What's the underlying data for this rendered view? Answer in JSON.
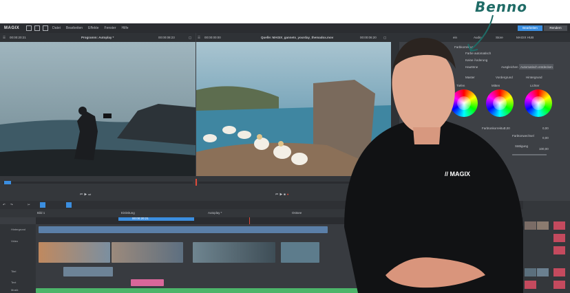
{
  "annotation": {
    "name": "Benno"
  },
  "app": {
    "logo": "MAGIX",
    "menu": [
      "Datei",
      "Bearbeiten",
      "Effekte",
      "Fenster",
      "Hilfe"
    ],
    "top_buttons": [
      {
        "label": "Bearbeiten",
        "color": "#3b8ee0"
      },
      {
        "label": "Rendern",
        "color": "#4b4e54"
      }
    ]
  },
  "program_monitor": {
    "timecode_left": "00:00:20:21",
    "title": "Programm: Autoplay *",
    "timecode_right": "00:00:08:23"
  },
  "source_monitor": {
    "timecode_left": "00:00:00:00",
    "title": "Quelle: MAGIX_gannets_yourday_themadox.mov",
    "timecode_right": "00:00:06:20"
  },
  "right_panel": {
    "tabs": [
      "ein",
      "Audio",
      "Store",
      "MAGIX HUB"
    ],
    "section_title": "Farbkorrektur",
    "options": [
      "Farbe automatisch",
      "Keine Änderung",
      "Hauttöne",
      "Ausgleichen",
      "Automatisch entdecken"
    ],
    "mode_options": [
      "Master",
      "Vordergrund",
      "Hintergrund"
    ],
    "wheel_labels": [
      "Tiefen",
      "Mitten",
      "Lichter"
    ],
    "slider_labels": [
      "Farbtonkorrektur",
      "Farbtonwechsel",
      "Sättigung"
    ],
    "slider_values": [
      "0,00",
      "0,00",
      "0,00",
      "100,00"
    ]
  },
  "timeline": {
    "tabs": [
      "Bild 1",
      "Einleitung",
      "Autoplay *",
      "Ostsee"
    ],
    "marker_timecode": "00:00:20:21",
    "tracks": [
      {
        "name": "Hintergrund"
      },
      {
        "name": "Video"
      },
      {
        "name": "Titel"
      },
      {
        "name": "Text"
      },
      {
        "name": "Musik"
      },
      {
        "name": "Audio"
      }
    ]
  },
  "colors": {
    "app_bg": "#3a3d42",
    "accent_blue": "#3b8ee0",
    "audio_green": "#4cb56a",
    "title_pink": "#d9679a",
    "annotation_teal": "#1f6b66"
  },
  "icons": [
    "new-file-icon",
    "open-icon",
    "save-icon",
    "play-icon",
    "pause-icon",
    "stop-icon",
    "record-icon",
    "scissors-icon",
    "arrow-icon",
    "magnify-icon"
  ]
}
